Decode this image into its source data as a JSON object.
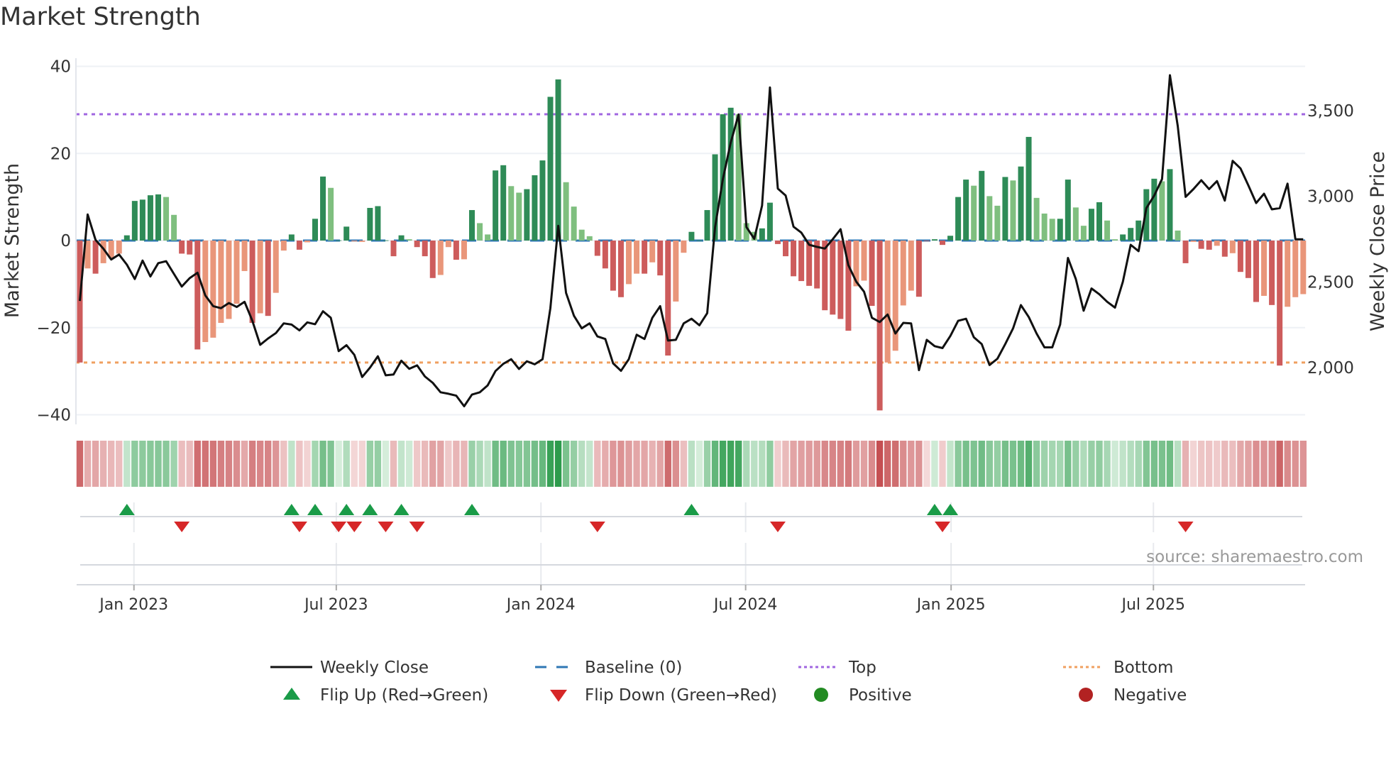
{
  "chart_data": {
    "type": "bar",
    "title": "Market Strength",
    "ylabel": "Market Strength",
    "y2label": "Weekly Close Price",
    "ylim": [
      -40,
      40
    ],
    "y2lim": [
      2000,
      3500
    ],
    "yticks": [
      "40",
      "20",
      "0",
      "−20",
      "−40"
    ],
    "y2ticks": [
      "3,500",
      "3,000",
      "2,500",
      "2,000"
    ],
    "xticks": [
      "Jan 2023",
      "Jul 2023",
      "Jan 2024",
      "Jul 2024",
      "Jan 2025",
      "Jul 2025"
    ],
    "top_level": 29,
    "bottom_level": -28,
    "strength": [
      -28,
      -6.4,
      -7.6,
      -5.2,
      -4,
      -3,
      1.2,
      9.1,
      9.4,
      10.4,
      10.6,
      10,
      5.9,
      -3,
      -3.2,
      -25,
      -23.3,
      -22.3,
      -18.9,
      -18,
      -14.5,
      -7,
      -18.9,
      -16.7,
      -17.3,
      -12,
      -2.3,
      1.4,
      -2.1,
      -0.4,
      5,
      14.7,
      12.1,
      0.05,
      3.2,
      -0.2,
      -0.3,
      7.5,
      7.9,
      0.05,
      -3.6,
      1.2,
      0.3,
      -1.5,
      -3.6,
      -8.6,
      -7.9,
      -1.5,
      -4.4,
      -4.3,
      7,
      4,
      1.4,
      16.1,
      17.3,
      12.5,
      11,
      11.8,
      15,
      18.4,
      33,
      37,
      13.4,
      7.8,
      2.5,
      1,
      -3.5,
      -6.4,
      -11.5,
      -13,
      -10,
      -7.6,
      -7.6,
      -5,
      -8,
      -26.4,
      -14,
      -2.8,
      2,
      0.05,
      7,
      19.8,
      29,
      30.5,
      29,
      4,
      2,
      2.8,
      8.7,
      -0.8,
      -3.6,
      -8.2,
      -9.3,
      -10.4,
      -11,
      -16,
      -17,
      -18,
      -20.7,
      -10.5,
      -9.2,
      -15,
      -39,
      -28,
      -25.3,
      -14.9,
      -11.5,
      -12.9,
      -0.05,
      0.3,
      -1,
      1.1,
      10,
      14,
      12.6,
      16,
      10.2,
      8,
      14.6,
      13.8,
      17,
      23.8,
      9.8,
      6.2,
      5,
      5,
      14,
      7.6,
      3.4,
      7.3,
      8.8,
      4.6,
      0.3,
      1.4,
      2.9,
      4.6,
      11.8,
      14.2,
      13.6,
      16.4,
      2.3,
      -5.2,
      -0.3,
      -1.9,
      -2.1,
      -1.2,
      -3.7,
      -2.9,
      -7.2,
      -8.6,
      -14.1,
      -12.7,
      -14.8,
      -28.7,
      -15.2,
      -13,
      -12.3
    ],
    "strength_shade": [
      1,
      0,
      1,
      0,
      0,
      0,
      1,
      1,
      1,
      1,
      1,
      0,
      0,
      1,
      1,
      1,
      0,
      0,
      0,
      0,
      0,
      0,
      1,
      0,
      1,
      0,
      0,
      1,
      1,
      0,
      1,
      1,
      0,
      1,
      1,
      0,
      0,
      1,
      1,
      1,
      1,
      1,
      0,
      1,
      1,
      1,
      0,
      0,
      1,
      0,
      1,
      0,
      0,
      1,
      1,
      0,
      0,
      1,
      1,
      1,
      1,
      1,
      0,
      0,
      0,
      0,
      1,
      1,
      1,
      1,
      0,
      0,
      1,
      0,
      1,
      1,
      0,
      0,
      1,
      1,
      1,
      1,
      1,
      1,
      0,
      0,
      0,
      1,
      1,
      1,
      1,
      1,
      1,
      1,
      1,
      1,
      1,
      1,
      1,
      0,
      0,
      1,
      1,
      0,
      0,
      0,
      0,
      1,
      1,
      1,
      1,
      1,
      1,
      1,
      0,
      1,
      0,
      0,
      1,
      0,
      1,
      1,
      0,
      0,
      0,
      1,
      1,
      0,
      0,
      1,
      1,
      0,
      0,
      1,
      1,
      1,
      1,
      1,
      0,
      1,
      0,
      1,
      0,
      1,
      1,
      0,
      1,
      0,
      1,
      1,
      1,
      0,
      1,
      1,
      0,
      0,
      0
    ],
    "weekly_close": [
      2389,
      2894,
      2746,
      2694,
      2631,
      2660,
      2601,
      2517,
      2625,
      2532,
      2610,
      2621,
      2547,
      2473,
      2522,
      2554,
      2421,
      2359,
      2347,
      2377,
      2354,
      2384,
      2273,
      2133,
      2170,
      2202,
      2258,
      2251,
      2217,
      2264,
      2253,
      2329,
      2291,
      2096,
      2131,
      2074,
      1945,
      2000,
      2066,
      1955,
      1960,
      2040,
      1993,
      2013,
      1948,
      1911,
      1856,
      1847,
      1836,
      1774,
      1842,
      1856,
      1896,
      1980,
      2022,
      2049,
      1992,
      2037,
      2019,
      2049,
      2347,
      2828,
      2436,
      2303,
      2229,
      2258,
      2182,
      2167,
      2025,
      1981,
      2049,
      2192,
      2167,
      2291,
      2359,
      2158,
      2162,
      2258,
      2285,
      2247,
      2318,
      2820,
      3101,
      3315,
      3478,
      2820,
      2752,
      2946,
      3636,
      3045,
      3005,
      2823,
      2788,
      2717,
      2705,
      2695,
      2749,
      2808,
      2598,
      2502,
      2443,
      2291,
      2266,
      2310,
      2199,
      2261,
      2258,
      1985,
      2162,
      2125,
      2114,
      2185,
      2273,
      2285,
      2177,
      2137,
      2015,
      2052,
      2137,
      2229,
      2365,
      2295,
      2199,
      2118,
      2118,
      2251,
      2640,
      2517,
      2332,
      2462,
      2428,
      2384,
      2350,
      2502,
      2717,
      2680,
      2931,
      3005,
      3101,
      3707,
      3411,
      2997,
      3042,
      3094,
      3042,
      3089,
      2975,
      3207,
      3163,
      3064,
      2961,
      3015,
      2924,
      2931,
      3074,
      2749,
      2749
    ],
    "flip_up_weeks": [
      6,
      27,
      30,
      34,
      37,
      41,
      50,
      78,
      109,
      111
    ],
    "flip_down_weeks": [
      13,
      28,
      33,
      35,
      39,
      43,
      66,
      89,
      110,
      141
    ],
    "legend": [
      {
        "label": "Weekly Close"
      },
      {
        "label": "Baseline (0)"
      },
      {
        "label": "Top"
      },
      {
        "label": "Bottom"
      },
      {
        "label": "Flip Up (Red→Green)"
      },
      {
        "label": "Flip Down (Green→Red)"
      },
      {
        "label": "Positive"
      },
      {
        "label": "Negative"
      }
    ],
    "legend_position": "bottom",
    "source": "source: sharemaestro.com",
    "colors": {
      "pos_strong": "#2e8b57",
      "pos_weak": "#7fbf7f",
      "neg_strong": "#cd5c5c",
      "neg_weak": "#e9967a",
      "line": "#111111",
      "baseline": "#2f77b4",
      "top": "#a066e0",
      "bottom": "#f0a060",
      "flip_up": "#1a9b48",
      "flip_down": "#d62728",
      "positive": "#228b22",
      "negative": "#b22222"
    }
  }
}
